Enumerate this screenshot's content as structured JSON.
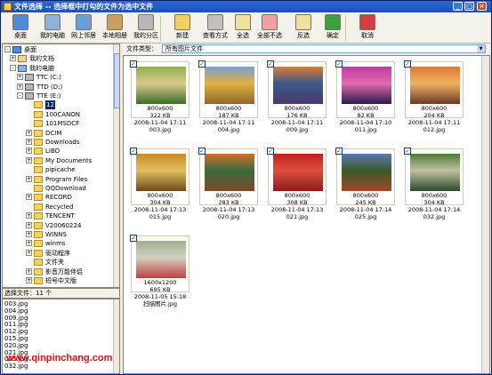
{
  "window": {
    "title": "文件选择 -- 选择框中打勾的文件为选中文件",
    "minimize": "_",
    "maximize": "□",
    "close": "×"
  },
  "toolbar": [
    {
      "label": "桌面",
      "icon": "desktop-icon"
    },
    {
      "label": "我的电脑",
      "icon": "computer-icon"
    },
    {
      "label": "网上邻居",
      "icon": "network-icon"
    },
    {
      "label": "本地相册",
      "icon": "album-icon"
    },
    {
      "label": "我的分区",
      "icon": "partition-icon"
    },
    {
      "label": "新建",
      "icon": "new-icon"
    },
    {
      "label": "查看方式",
      "icon": "view-icon"
    },
    {
      "label": "全选",
      "icon": "select-all-icon"
    },
    {
      "label": "全部不选",
      "icon": "deselect-all-icon"
    },
    {
      "label": "反选",
      "icon": "invert-icon"
    },
    {
      "label": "确定",
      "icon": "ok-icon"
    },
    {
      "label": "取消",
      "icon": "cancel-icon"
    }
  ],
  "tree": [
    {
      "label": "桌面",
      "type": "desk",
      "expander": "-"
    },
    {
      "label": "我的文档",
      "type": "docs",
      "expander": "+"
    },
    {
      "label": "我的电脑",
      "type": "pc",
      "expander": "-"
    },
    {
      "label": "TTC (C:)",
      "type": "drive",
      "expander": "+"
    },
    {
      "label": "TTD (D:)",
      "type": "drive",
      "expander": "+"
    },
    {
      "label": "TTE (E:)",
      "type": "drive",
      "expander": "-"
    },
    {
      "label": "12",
      "type": "folder",
      "expander": "",
      "selected": true
    },
    {
      "label": "100CANON",
      "type": "folder",
      "expander": ""
    },
    {
      "label": "101MSDCF",
      "type": "folder",
      "expander": ""
    },
    {
      "label": "DCIM",
      "type": "folder",
      "expander": "+"
    },
    {
      "label": "Downloads",
      "type": "folder",
      "expander": "+"
    },
    {
      "label": "LIBD",
      "type": "folder",
      "expander": "+"
    },
    {
      "label": "My Documents",
      "type": "folder",
      "expander": "+"
    },
    {
      "label": "pipicache",
      "type": "folder",
      "expander": ""
    },
    {
      "label": "Program Files",
      "type": "folder",
      "expander": "+"
    },
    {
      "label": "QQDownload",
      "type": "folder",
      "expander": ""
    },
    {
      "label": "RECORD",
      "type": "folder",
      "expander": "+"
    },
    {
      "label": "Recycled",
      "type": "folder",
      "expander": ""
    },
    {
      "label": "TENCENT",
      "type": "folder",
      "expander": "+"
    },
    {
      "label": "V20060224",
      "type": "folder",
      "expander": "+"
    },
    {
      "label": "WINNS",
      "type": "folder",
      "expander": "+"
    },
    {
      "label": "winms",
      "type": "folder",
      "expander": "+"
    },
    {
      "label": "驱动程序",
      "type": "folder",
      "expander": "+"
    },
    {
      "label": "文件夹",
      "type": "folder",
      "expander": ""
    },
    {
      "label": "影音万能伴侣",
      "type": "folder",
      "expander": "+"
    },
    {
      "label": "短号中文版",
      "type": "folder",
      "expander": "+"
    }
  ],
  "selection": {
    "label": "选择文件：11 个"
  },
  "selected_files": [
    "003.jpg",
    "004.jpg",
    "009.jpg",
    "011.jpg",
    "012.jpg",
    "015.jpg",
    "020.jpg",
    "021.jpg",
    "025.jpg",
    "032.jpg"
  ],
  "filetype": {
    "label": "文件类型：",
    "value": "所有图片文件"
  },
  "thumbnails": [
    {
      "dims": "800x600",
      "size": "322 KB",
      "date": "2008-11-04 17:11",
      "name": "003.jpg",
      "colors": [
        "#8fb04a",
        "#3f6b2a",
        "#d9c98a"
      ],
      "checked": true
    },
    {
      "dims": "800x600",
      "size": "187 KB",
      "date": "2008-11-04 17:11",
      "name": "004.jpg",
      "colors": [
        "#7a9fd0",
        "#8c6a2a",
        "#e0b040"
      ],
      "checked": true
    },
    {
      "dims": "800x600",
      "size": "176 KB",
      "date": "2008-11-04 17:11",
      "name": "009.jpg",
      "colors": [
        "#e07a30",
        "#4a3a6a",
        "#3a5a8a"
      ],
      "checked": true
    },
    {
      "dims": "800x600",
      "size": "82 KB",
      "date": "2008-11-04 17:10",
      "name": "011.jpg",
      "colors": [
        "#c23aa0",
        "#2a1a4a",
        "#e06ab0"
      ],
      "checked": true
    },
    {
      "dims": "800x600",
      "size": "204 KB",
      "date": "2008-11-04 17:11",
      "name": "012.jpg",
      "colors": [
        "#e07a30",
        "#6a3a2a",
        "#f0b060"
      ],
      "checked": true
    },
    {
      "dims": "800x600",
      "size": "304 KB",
      "date": "2008-11-04 17:13",
      "name": "015.jpg",
      "colors": [
        "#c88a2a",
        "#6a4a1a",
        "#e0c060"
      ],
      "checked": true
    },
    {
      "dims": "800x600",
      "size": "283 KB",
      "date": "2008-11-04 17:13",
      "name": "020.jpg",
      "colors": [
        "#d07030",
        "#7a4a2a",
        "#3a6a3a"
      ],
      "checked": true
    },
    {
      "dims": "800x600",
      "size": "308 KB",
      "date": "2008-11-04 17:13",
      "name": "021.jpg",
      "colors": [
        "#c02020",
        "#8a1a1a",
        "#e05040"
      ],
      "checked": true
    },
    {
      "dims": "800x600",
      "size": "245 KB",
      "date": "2008-11-04 17:14",
      "name": "025.jpg",
      "colors": [
        "#5a7ab0",
        "#a04a2a",
        "#3a5a2a"
      ],
      "checked": true
    },
    {
      "dims": "800x600",
      "size": "304 KB",
      "date": "2008-11-04 17:14",
      "name": "032.jpg",
      "colors": [
        "#4a7a3a",
        "#2a4a2a",
        "#c0c0a0"
      ],
      "checked": true
    },
    {
      "dims": "1600x1200",
      "size": "695 KB",
      "date": "2008-11-05 15:18",
      "name": "扫描图片.jpg",
      "colors": [
        "#a0b090",
        "#c04040",
        "#d0d0c0"
      ],
      "checked": true
    }
  ],
  "watermark": "www.qinpinchang.com"
}
